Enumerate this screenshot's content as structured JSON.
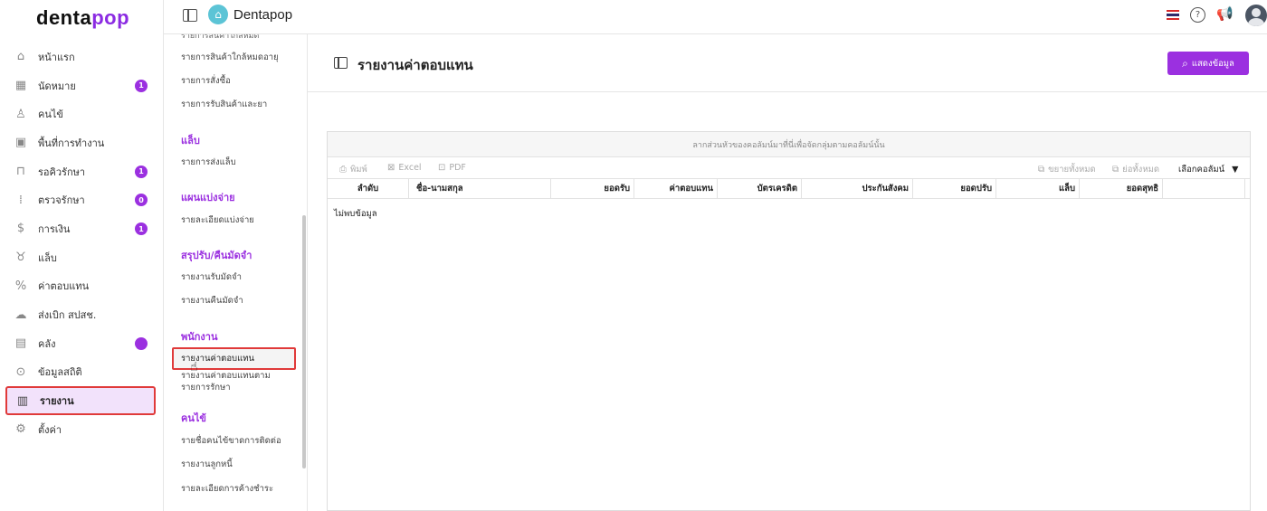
{
  "brand": {
    "logo_main": "denta",
    "logo_accent": "pop",
    "app_title": "Dentapop"
  },
  "sidebar": {
    "items": [
      {
        "label": "หน้าแรก",
        "icon": "home-icon",
        "badge": ""
      },
      {
        "label": "นัดหมาย",
        "icon": "calendar-icon",
        "badge": "1"
      },
      {
        "label": "คนไข้",
        "icon": "user-icon",
        "badge": ""
      },
      {
        "label": "พื้นที่การทำงาน",
        "icon": "workspace-icon",
        "badge": ""
      },
      {
        "label": "รอคิวรักษา",
        "icon": "sofa-icon",
        "badge": "1"
      },
      {
        "label": "ตรวจรักษา",
        "icon": "dental-tools-icon",
        "badge": "0"
      },
      {
        "label": "การเงิน",
        "icon": "money-hand-icon",
        "badge": "1"
      },
      {
        "label": "แล็บ",
        "icon": "tooth-icon",
        "badge": ""
      },
      {
        "label": "ค่าตอบแทน",
        "icon": "percent-icon",
        "badge": ""
      },
      {
        "label": "ส่งเบิก สปสช.",
        "icon": "cloud-icon",
        "badge": ""
      },
      {
        "label": "คลัง",
        "icon": "box-icon",
        "badge": "•"
      },
      {
        "label": "ข้อมูลสถิติ",
        "icon": "stats-icon",
        "badge": ""
      },
      {
        "label": "รายงาน",
        "icon": "report-icon",
        "badge": ""
      },
      {
        "label": "ตั้งค่า",
        "icon": "gear-icon",
        "badge": ""
      }
    ]
  },
  "submenu": {
    "cut_off_item": "รายการสินค้าใกล้หมด",
    "inventory_links": [
      "รายการสินค้าใกล้หมดอายุ",
      "รายการสั่งซื้อ",
      "รายการรับสินค้าและยา"
    ],
    "lab_heading": "แล็บ",
    "lab_links": [
      "รายการส่งแล็บ"
    ],
    "split_heading": "แผนแบ่งจ่าย",
    "split_links": [
      "รายละเอียดแบ่งจ่าย"
    ],
    "deposit_heading": "สรุปรับ/คืนมัดจำ",
    "deposit_links": [
      "รายงานรับมัดจำ",
      "รายงานคืนมัดจำ"
    ],
    "staff_heading": "พนักงาน",
    "staff_active": "รายงานค่าตอบแทน",
    "staff_second": "รายงานค่าตอบแทนตาม รายการรักษา",
    "patient_heading": "คนไข้",
    "patient_links": [
      "รายชื่อคนไข้ขาดการติดต่อ",
      "รายงานลูกหนี้",
      "รายละเอียดการค้างชำระ"
    ]
  },
  "page": {
    "title": "รายงานค่าตอบแทน",
    "show_button": "แสดงข้อมูล"
  },
  "grid": {
    "group_panel_text": "ลากส่วนหัวของคอลัมน์มาที่นี่เพื่อจัดกลุ่มตามคอลัมน์นั้น",
    "toolbar": {
      "print": "พิมพ์",
      "excel": "Excel",
      "pdf": "PDF",
      "expand_all": "ขยายทั้งหมด",
      "collapse_all": "ย่อทั้งหมด",
      "choose_columns": "เลือกคอลัมน์"
    },
    "columns": [
      "ลำดับ",
      "ชื่อ-นามสกุล",
      "ยอดรับ",
      "ค่าตอบแทน",
      "บัตรเครดิต",
      "ประกันสังคม",
      "ยอดปรับ",
      "แล็บ",
      "ยอดสุทธิ"
    ],
    "empty_text": "ไม่พบข้อมูล"
  }
}
